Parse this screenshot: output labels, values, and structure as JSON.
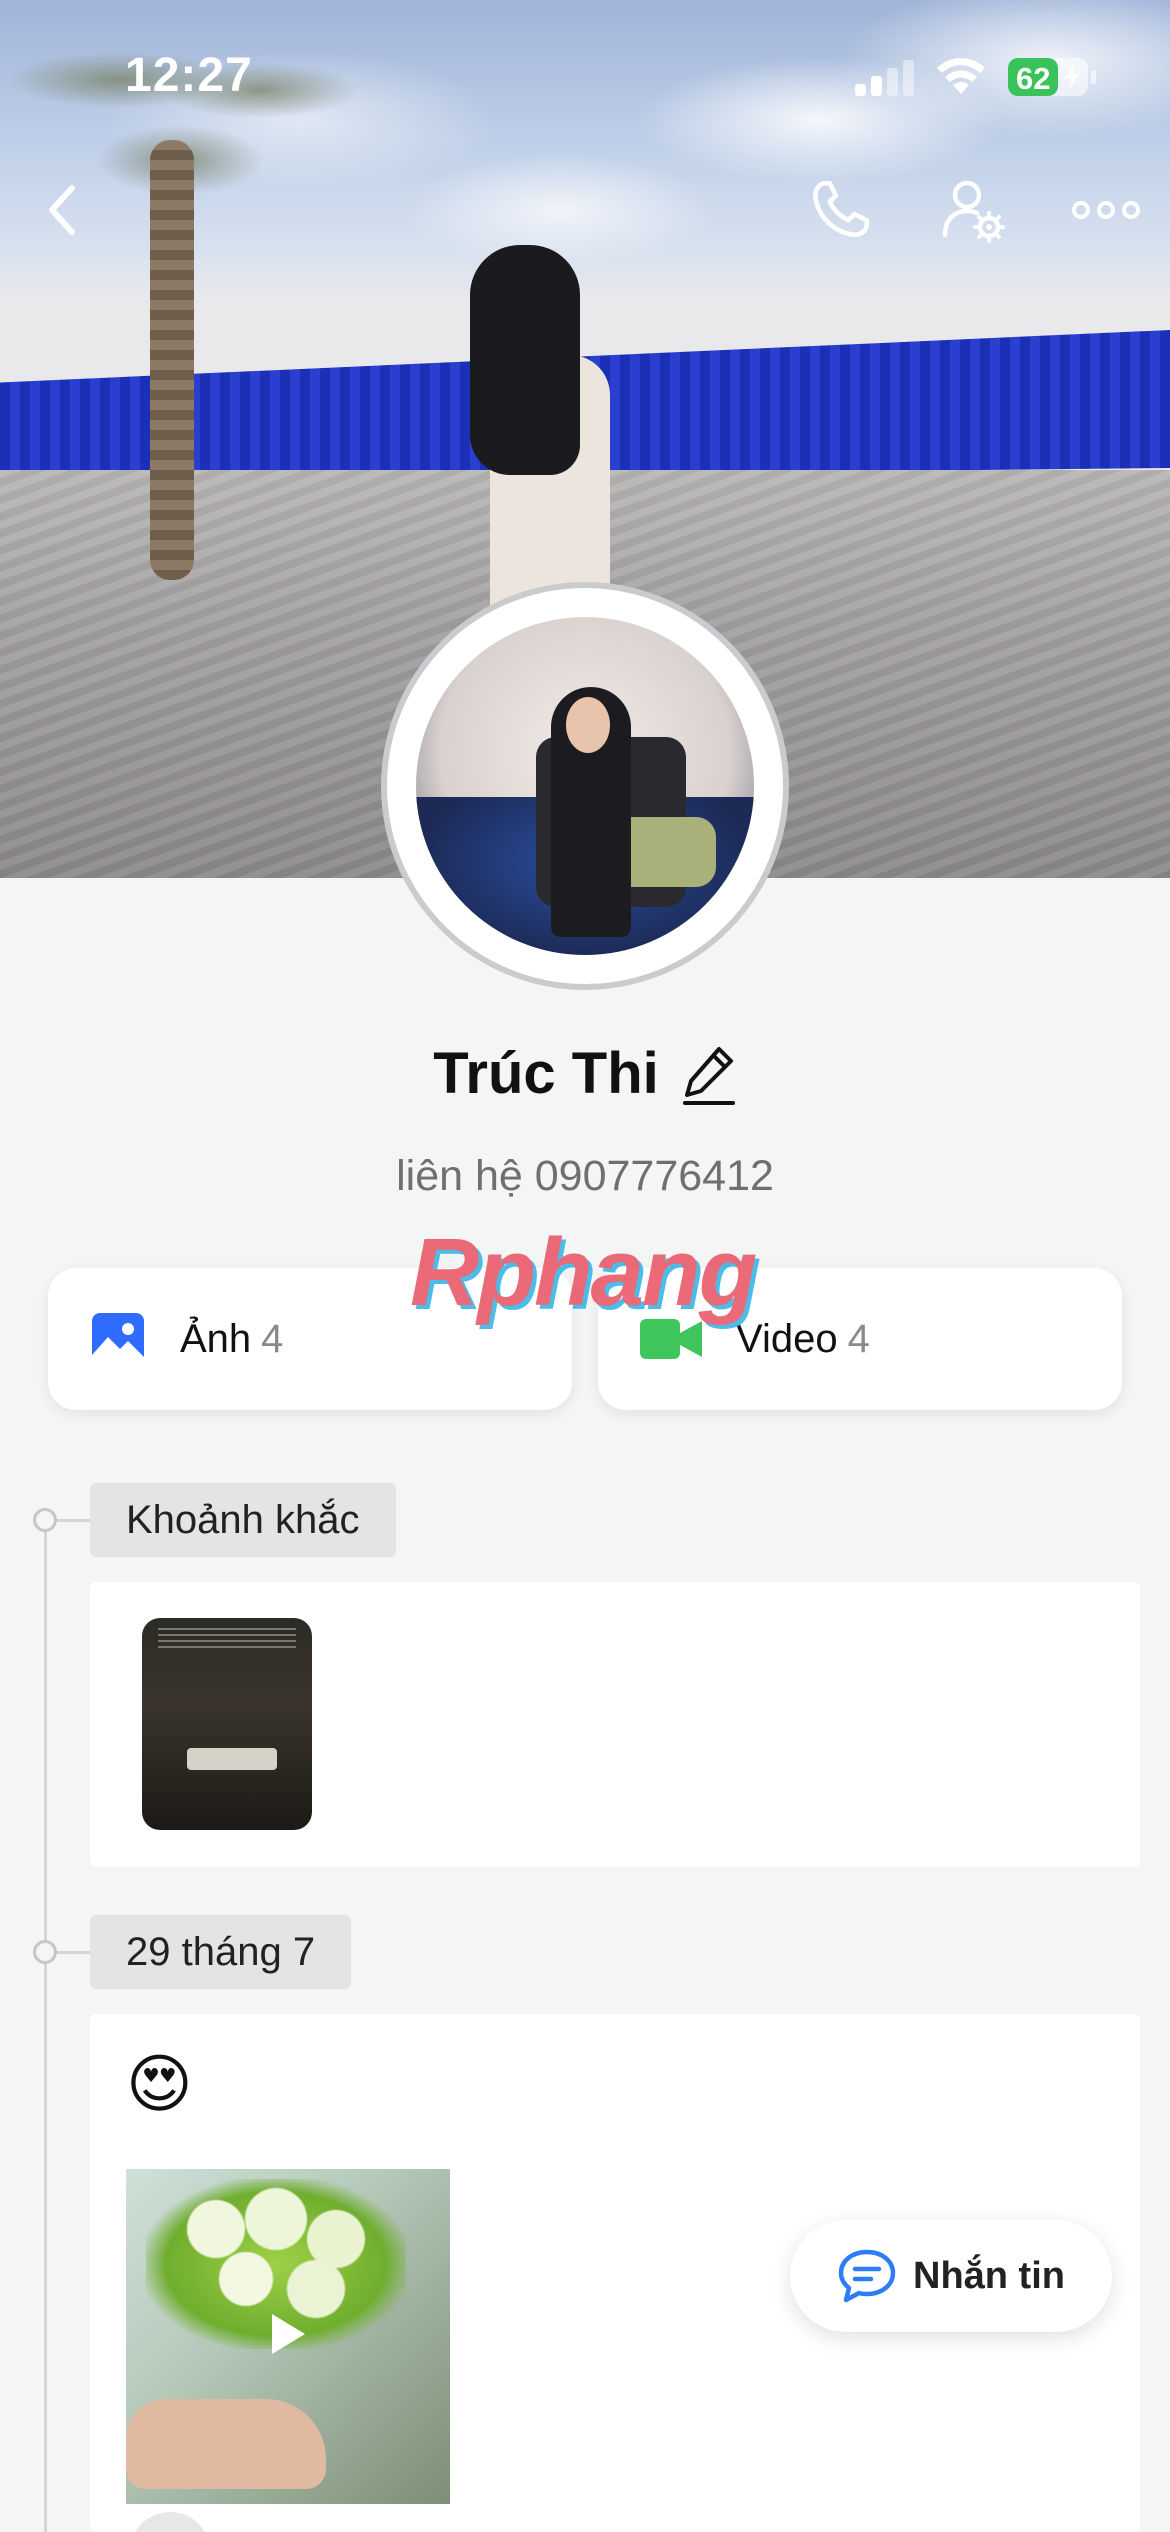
{
  "status_bar": {
    "time": "12:27",
    "battery": "62",
    "battery_level_percent": 62
  },
  "nav": {
    "back_icon": "chevron-left-icon",
    "call_icon": "phone-icon",
    "settings_icon": "user-gear-icon",
    "more_icon": "more-horizontal-icon"
  },
  "profile": {
    "name": "Trúc Thi",
    "subtitle": "liên hệ 0907776412",
    "edit_icon": "pencil-icon"
  },
  "watermark": "Rphang",
  "media": {
    "photos": {
      "label": "Ảnh",
      "count": "4",
      "icon": "image-icon",
      "color": "#2f6bff"
    },
    "videos": {
      "label": "Video",
      "count": "4",
      "icon": "video-camera-icon",
      "color": "#3ec55c"
    }
  },
  "timeline": {
    "moments_label": "Khoảnh khắc",
    "date_label": "29 tháng 7",
    "post_emoji": "😍"
  },
  "fab": {
    "label": "Nhắn tin",
    "icon": "chat-bubble-icon",
    "color": "#2f7cf6"
  }
}
